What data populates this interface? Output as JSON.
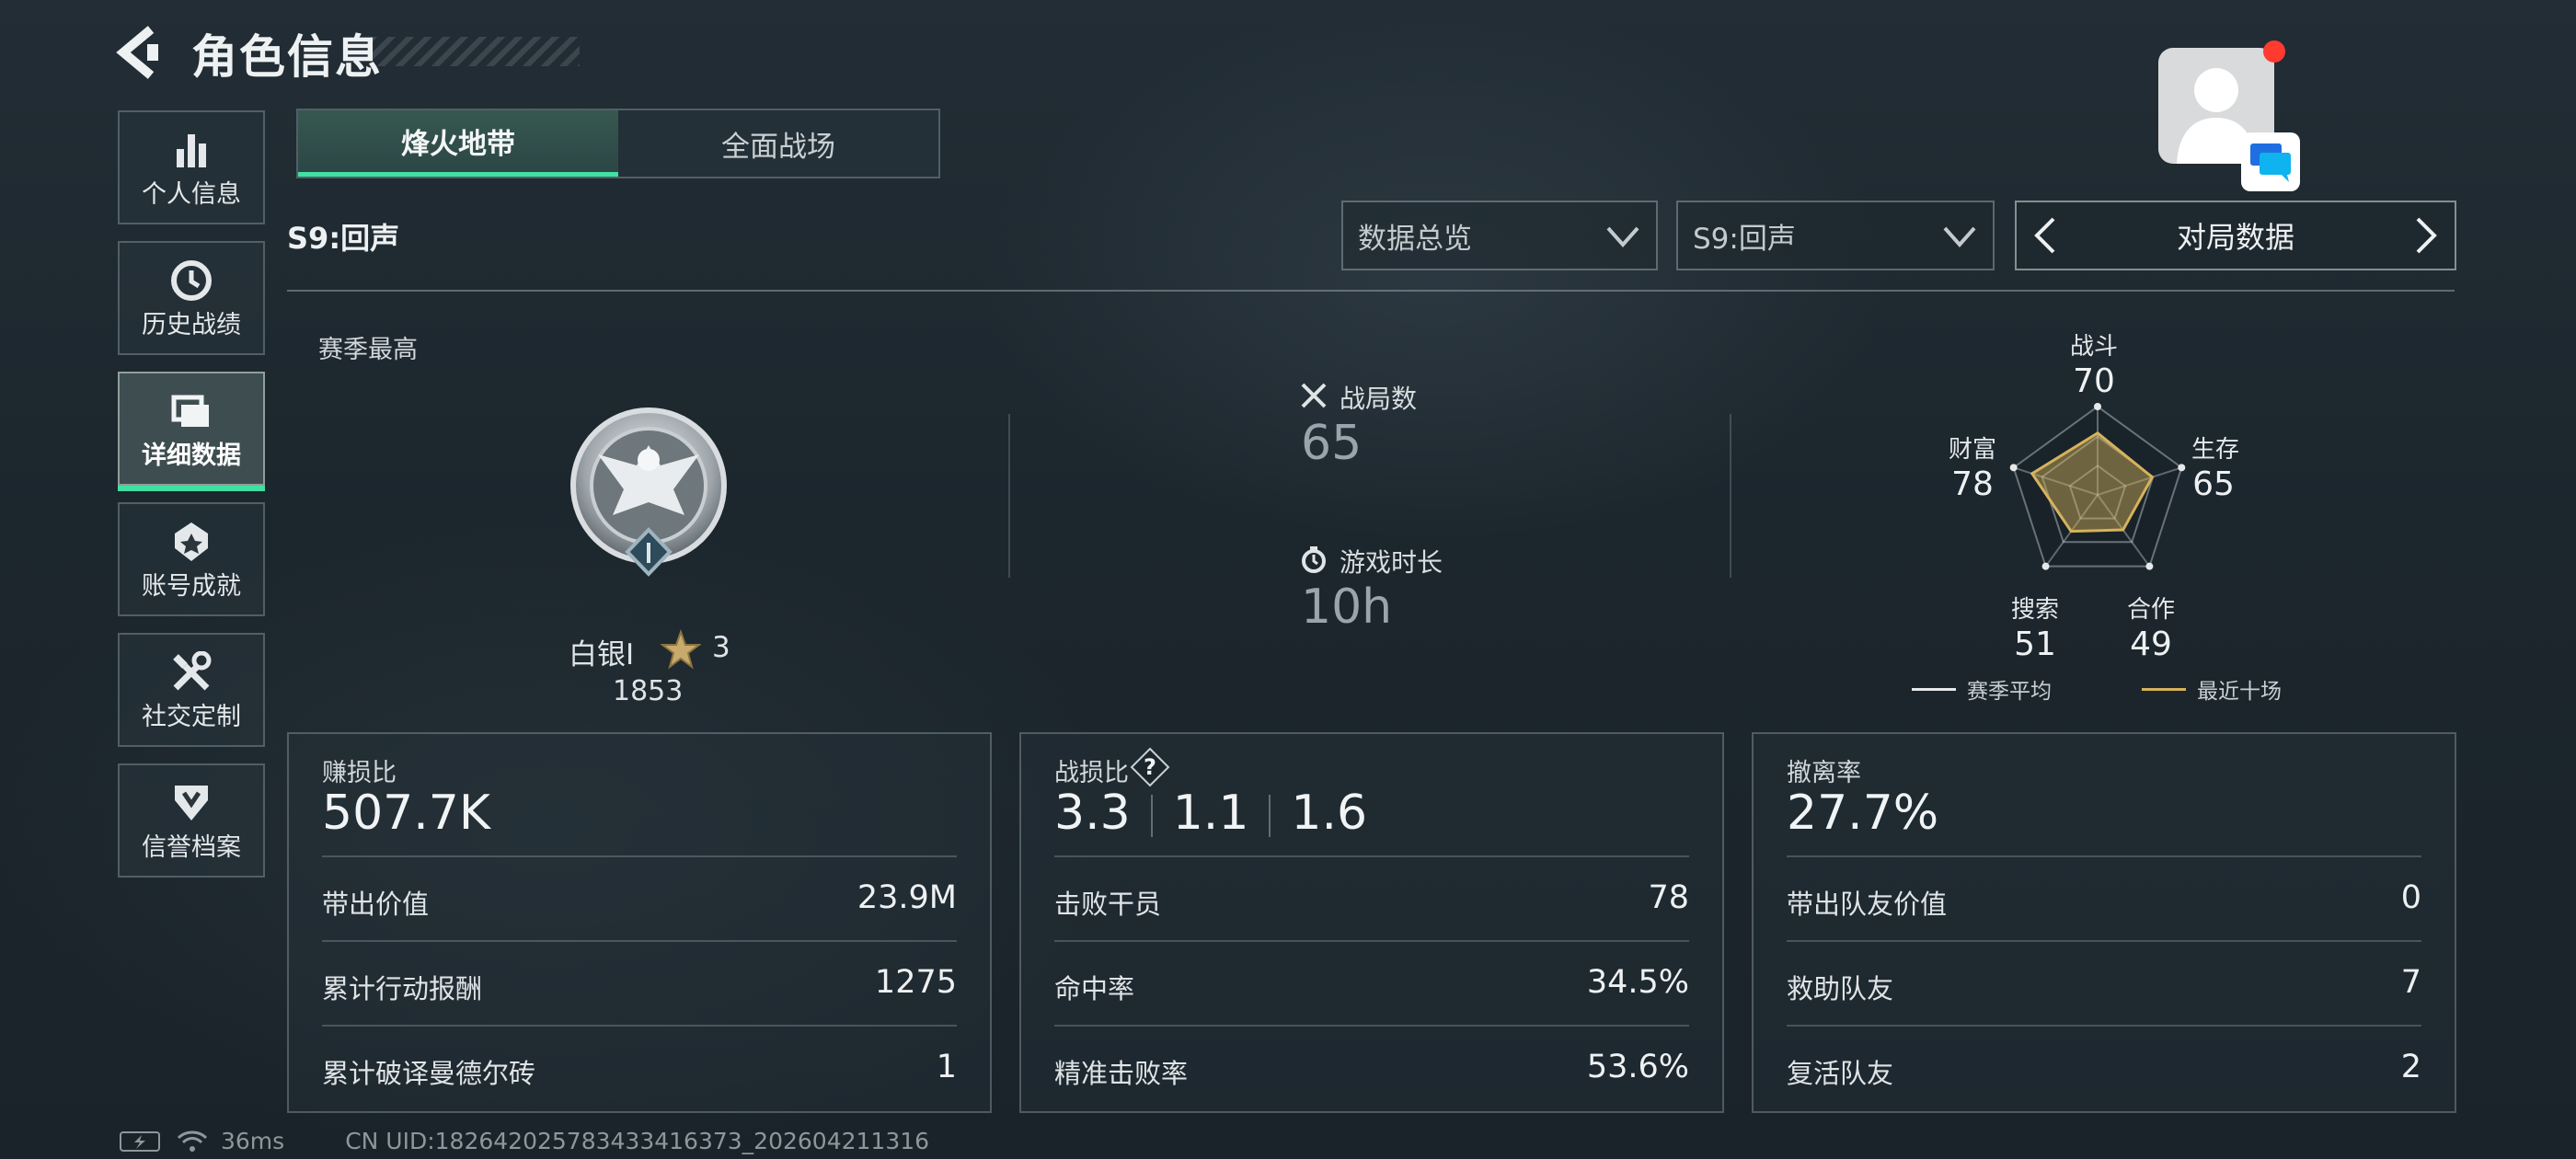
{
  "header": {
    "title": "角色信息"
  },
  "sidebar": {
    "items": [
      {
        "label": "个人信息",
        "icon": "bar-chart-icon",
        "active": false
      },
      {
        "label": "历史战绩",
        "icon": "history-clock-icon",
        "active": false
      },
      {
        "label": "详细数据",
        "icon": "detail-cards-icon",
        "active": true
      },
      {
        "label": "账号成就",
        "icon": "achievement-badge-icon",
        "active": false
      },
      {
        "label": "社交定制",
        "icon": "tools-icon",
        "active": false
      },
      {
        "label": "信誉档案",
        "icon": "credit-shield-icon",
        "active": false
      }
    ]
  },
  "tabs": [
    {
      "label": "烽火地带",
      "active": true
    },
    {
      "label": "全面战场",
      "active": false
    }
  ],
  "season_label": "S9:回声",
  "filters": {
    "mode": {
      "value": "数据总览"
    },
    "season": {
      "value": "S9:回声"
    },
    "pager": {
      "label": "对局数据"
    }
  },
  "summary": {
    "season_best_label": "赛季最高",
    "rank_name": "白银I",
    "rank_stars": "3",
    "rank_score": "1853",
    "matches_label": "战局数",
    "matches_value": "65",
    "playtime_label": "游戏时长",
    "playtime_value": "10h"
  },
  "radar": {
    "labels": {
      "combat": "战斗",
      "survival": "生存",
      "cooperation": "合作",
      "search": "搜索",
      "wealth": "财富"
    },
    "values": {
      "combat": 70,
      "survival": 65,
      "cooperation": 49,
      "search": 51,
      "wealth": 78
    },
    "legend_avg": "赛季平均",
    "legend_recent": "最近十场",
    "colors": {
      "avg": "#e6e9ea",
      "recent": "#d6b35a"
    }
  },
  "panels": {
    "profit": {
      "title": "赚损比",
      "value": "507.7K",
      "rows": [
        {
          "label": "带出价值",
          "value": "23.9M"
        },
        {
          "label": "累计行动报酬",
          "value": "1275"
        },
        {
          "label": "累计破译曼德尔砖",
          "value": "1"
        }
      ]
    },
    "kd": {
      "title": "战损比",
      "values": [
        "3.3",
        "1.1",
        "1.6"
      ],
      "rows": [
        {
          "label": "击败干员",
          "value": "78"
        },
        {
          "label": "命中率",
          "value": "34.5%"
        },
        {
          "label": "精准击败率",
          "value": "53.6%"
        }
      ]
    },
    "extract": {
      "title": "撤离率",
      "value": "27.7%",
      "rows": [
        {
          "label": "带出队友价值",
          "value": "0"
        },
        {
          "label": "救助队友",
          "value": "7"
        },
        {
          "label": "复活队友",
          "value": "2"
        }
      ]
    }
  },
  "footer": {
    "ping": "36ms",
    "uid": "CN UID:1826420257834334163​73_202604211316"
  },
  "colors": {
    "accent": "#3fe0a2",
    "notification": "#ff3b30",
    "chat": "#1f6fe0"
  }
}
